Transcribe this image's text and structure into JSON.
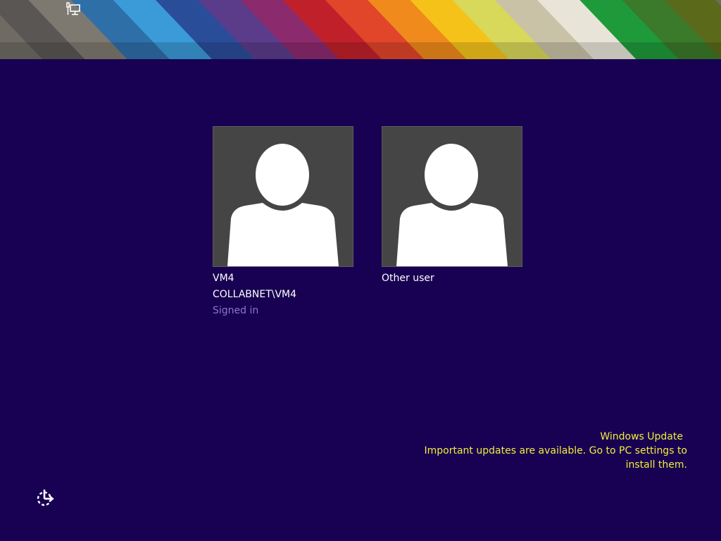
{
  "banner": {
    "stripe_colors": [
      "#5a5654",
      "#7e7970",
      "#2e6fa8",
      "#3a9bd8",
      "#2a4d9a",
      "#5b3c8a",
      "#8c2a6e",
      "#c0202a",
      "#e1452a",
      "#f08a1c",
      "#f5c21a",
      "#d8d85a",
      "#c9c2a6",
      "#e8e4d8",
      "#1f9a3a",
      "#3a7a2a",
      "#5a6a1a"
    ],
    "network_icon": "network-monitor-icon"
  },
  "users": [
    {
      "name": "VM4",
      "account": "COLLABNET\\VM4",
      "status": "Signed in",
      "icon": "user-avatar-icon"
    },
    {
      "name": "Other user",
      "icon": "user-avatar-icon"
    }
  ],
  "update_notice": {
    "title": "Windows Update",
    "line1": "Important updates are available. Go to PC settings to",
    "line2": "install them.",
    "color": "#f1ee3c"
  },
  "ease_of_access": {
    "icon": "ease-of-access-icon"
  },
  "colors": {
    "background": "#180052",
    "tile": "#454545",
    "signed_in_text": "#8a79c6"
  }
}
